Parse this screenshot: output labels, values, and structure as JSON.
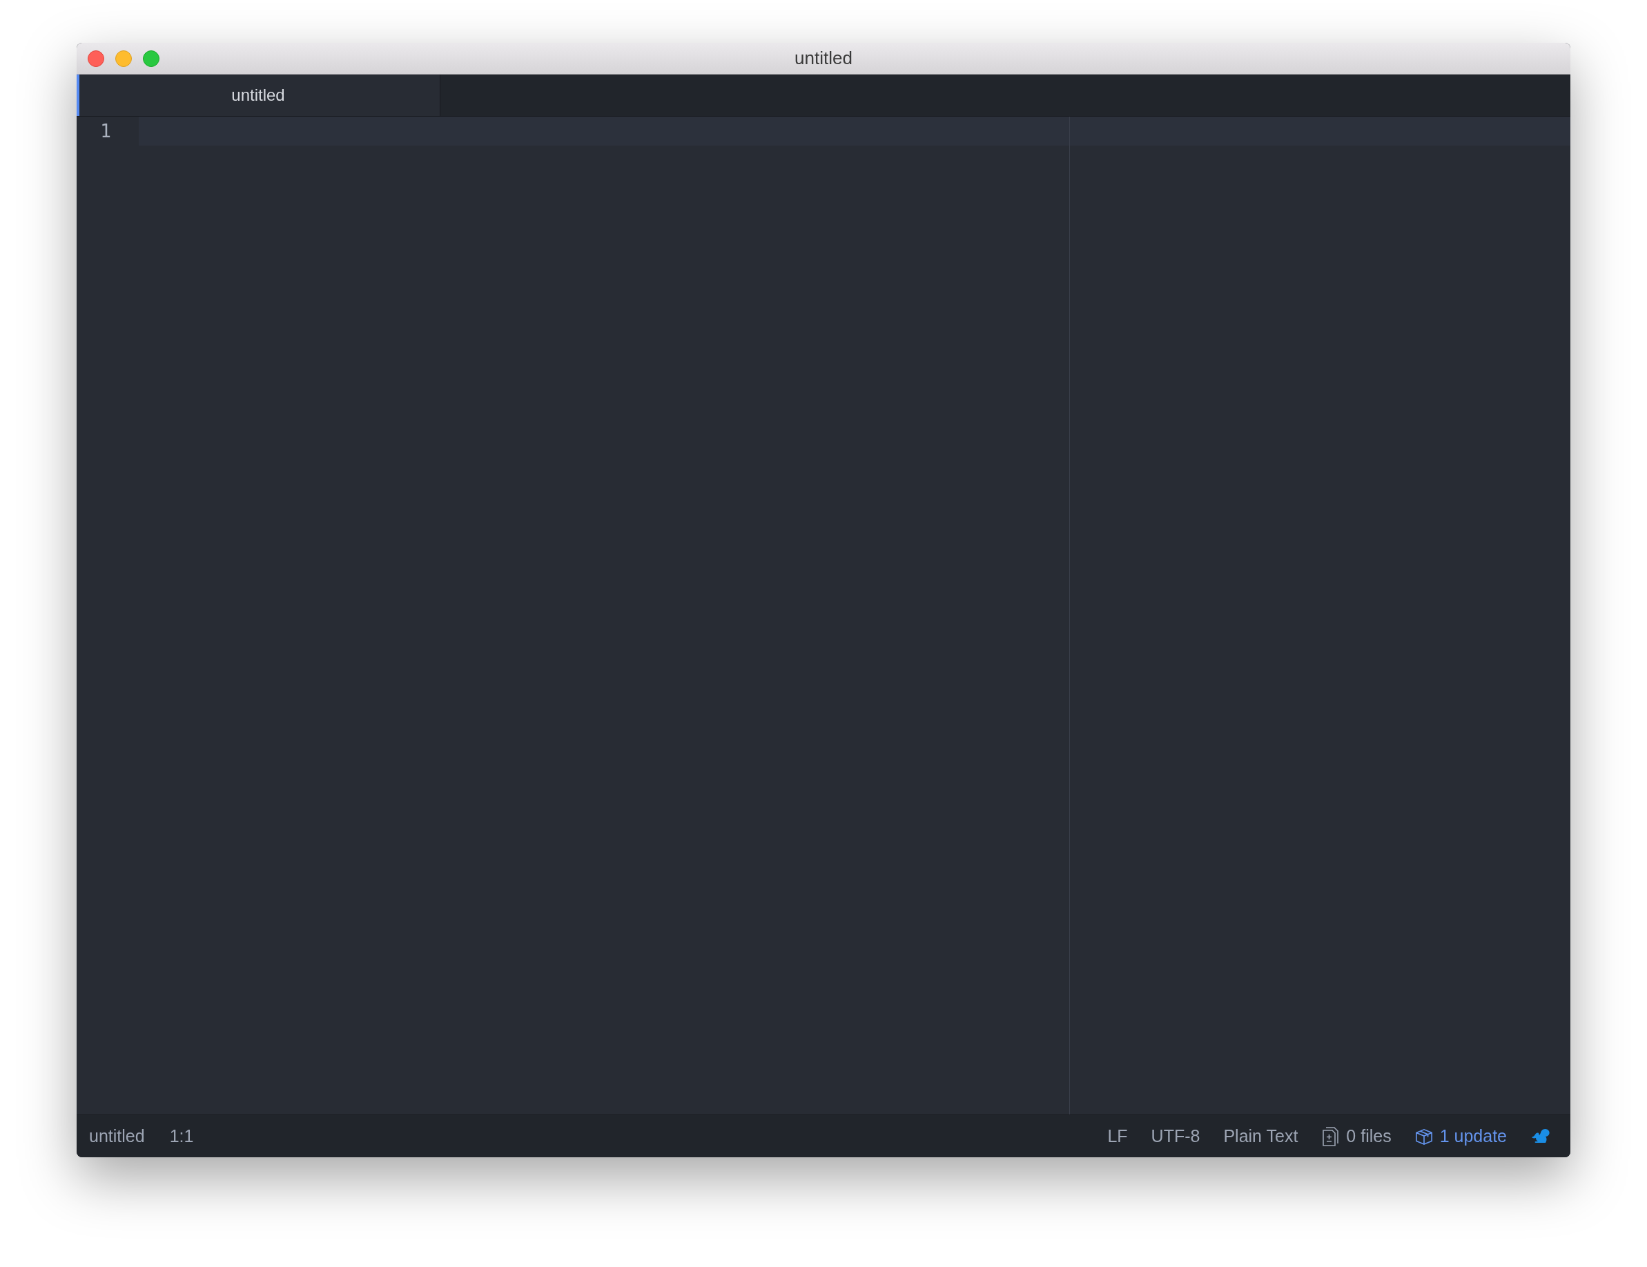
{
  "window": {
    "title": "untitled"
  },
  "tabs": [
    {
      "label": "untitled",
      "selected": true
    }
  ],
  "editor": {
    "lines": [
      {
        "number": "1",
        "current": true
      }
    ]
  },
  "status_bar": {
    "left": [
      "untitled",
      "1:1"
    ],
    "right": [
      {
        "kind": "text",
        "label": "LF"
      },
      {
        "kind": "text",
        "label": "UTF-8"
      },
      {
        "kind": "text",
        "label": "Plain Text"
      },
      {
        "kind": "files",
        "label": "0 files"
      },
      {
        "kind": "update",
        "label": "1 update"
      }
    ]
  }
}
